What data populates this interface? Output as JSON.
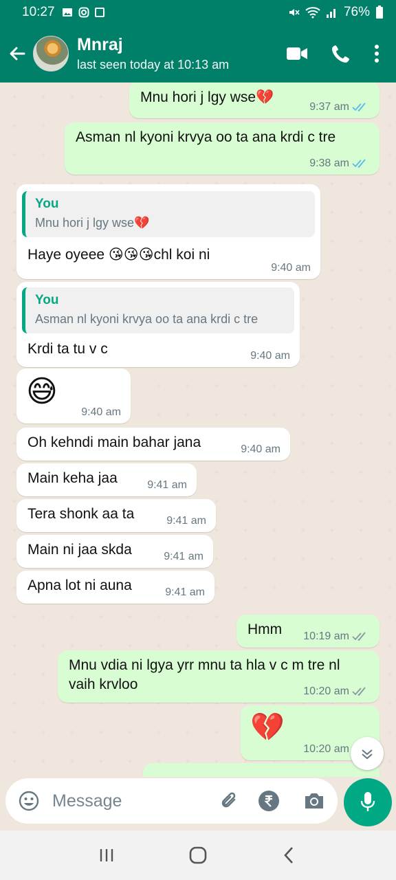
{
  "status_bar": {
    "time": "10:27",
    "battery": "76%"
  },
  "header": {
    "contact_name": "Mnraj",
    "last_seen": "last seen today at 10:13 am"
  },
  "messages": [
    {
      "dir": "out",
      "text": "Mnu hori j lgy wse💔",
      "time": "9:37 am",
      "ticks": "read"
    },
    {
      "dir": "out",
      "text": "Asman nl kyoni krvya oo ta ana krdi c tre",
      "time": "9:38 am",
      "ticks": "read"
    },
    {
      "dir": "in",
      "quote_author": "You",
      "quote_text": "Mnu hori j lgy wse💔",
      "text": "Haye oyeee 😘😘😘chl koi ni",
      "time": "9:40 am"
    },
    {
      "dir": "in",
      "quote_author": "You",
      "quote_text": "Asman nl kyoni krvya oo ta ana krdi c tre",
      "text": "Krdi ta tu v c",
      "time": "9:40 am"
    },
    {
      "dir": "in",
      "text": "😅",
      "time": "9:40 am"
    },
    {
      "dir": "in",
      "text": "Oh kehndi main bahar jana",
      "time": "9:40 am"
    },
    {
      "dir": "in",
      "text": "Main keha jaa",
      "time": "9:41 am"
    },
    {
      "dir": "in",
      "text": "Tera shonk aa ta",
      "time": "9:41 am"
    },
    {
      "dir": "in",
      "text": "Main ni jaa skda",
      "time": "9:41 am"
    },
    {
      "dir": "in",
      "text": "Apna lot ni auna",
      "time": "9:41 am"
    },
    {
      "dir": "out",
      "text": "Hmm",
      "time": "10:19 am",
      "ticks": "delivered"
    },
    {
      "dir": "out",
      "text": "Mnu vdia ni lgya yrr mnu ta hla v c m tre nl vaih krvloo",
      "time": "10:20 am",
      "ticks": "delivered"
    },
    {
      "dir": "out",
      "text": "💔",
      "time": "10:20 am",
      "ticks": "delivered"
    }
  ],
  "composer": {
    "placeholder": "Message"
  },
  "icons": [
    "back-arrow-icon",
    "video-call-icon",
    "phone-icon",
    "more-vert-icon",
    "emoji-icon",
    "attach-icon",
    "rupee-icon",
    "camera-icon",
    "mic-icon",
    "chevron-down-icon"
  ],
  "colors": {
    "header": "#008069",
    "outgoing_bubble": "#d9fdd3",
    "incoming_bubble": "#ffffff",
    "chat_bg": "#efe7dd",
    "accent": "#00a884",
    "read_tick": "#53bdeb"
  }
}
